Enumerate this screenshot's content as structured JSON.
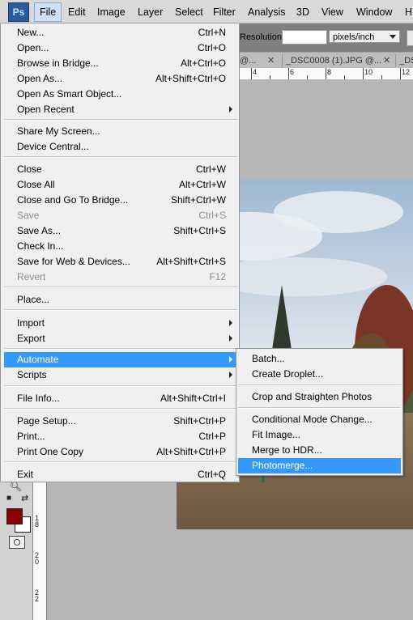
{
  "menubar": {
    "logo": "Ps",
    "items": [
      "File",
      "Edit",
      "Image",
      "Layer",
      "Select",
      "Filter",
      "Analysis",
      "3D",
      "View",
      "Window",
      "H"
    ]
  },
  "options": {
    "resolution_label": "Resolution:",
    "resolution_value": "",
    "unit_selected": "pixels/inch"
  },
  "tabs": [
    "@...",
    "_DSC0008 (1).JPG @...",
    "_DS"
  ],
  "ruler": {
    "h_labels": [
      "4",
      "6",
      "8",
      "10",
      "12"
    ],
    "v_labels": [
      "1\n8",
      "2\n0",
      "2\n2"
    ]
  },
  "file_menu": {
    "items": [
      {
        "label": "New...",
        "shortcut": "Ctrl+N"
      },
      {
        "label": "Open...",
        "shortcut": "Ctrl+O"
      },
      {
        "label": "Browse in Bridge...",
        "shortcut": "Alt+Ctrl+O"
      },
      {
        "label": "Open As...",
        "shortcut": "Alt+Shift+Ctrl+O"
      },
      {
        "label": "Open As Smart Object...",
        "shortcut": ""
      },
      {
        "label": "Open Recent",
        "shortcut": ""
      },
      {
        "label": "Share My Screen...",
        "shortcut": ""
      },
      {
        "label": "Device Central...",
        "shortcut": ""
      },
      {
        "label": "Close",
        "shortcut": "Ctrl+W"
      },
      {
        "label": "Close All",
        "shortcut": "Alt+Ctrl+W"
      },
      {
        "label": "Close and Go To Bridge...",
        "shortcut": "Shift+Ctrl+W"
      },
      {
        "label": "Save",
        "shortcut": "Ctrl+S"
      },
      {
        "label": "Save As...",
        "shortcut": "Shift+Ctrl+S"
      },
      {
        "label": "Check In...",
        "shortcut": ""
      },
      {
        "label": "Save for Web & Devices...",
        "shortcut": "Alt+Shift+Ctrl+S"
      },
      {
        "label": "Revert",
        "shortcut": "F12"
      },
      {
        "label": "Place...",
        "shortcut": ""
      },
      {
        "label": "Import",
        "shortcut": ""
      },
      {
        "label": "Export",
        "shortcut": ""
      },
      {
        "label": "Automate",
        "shortcut": ""
      },
      {
        "label": "Scripts",
        "shortcut": ""
      },
      {
        "label": "File Info...",
        "shortcut": "Alt+Shift+Ctrl+I"
      },
      {
        "label": "Page Setup...",
        "shortcut": "Shift+Ctrl+P"
      },
      {
        "label": "Print...",
        "shortcut": "Ctrl+P"
      },
      {
        "label": "Print One Copy",
        "shortcut": "Alt+Shift+Ctrl+P"
      },
      {
        "label": "Exit",
        "shortcut": "Ctrl+Q"
      }
    ]
  },
  "automate_submenu": {
    "items": [
      {
        "label": "Batch..."
      },
      {
        "label": "Create Droplet..."
      },
      {
        "label": "Crop and Straighten Photos"
      },
      {
        "label": "Conditional Mode Change..."
      },
      {
        "label": "Fit Image..."
      },
      {
        "label": "Merge to HDR..."
      },
      {
        "label": "Photomerge..."
      }
    ]
  },
  "colors": {
    "highlight": "#3399ff",
    "foreground_swatch": "#8b0000",
    "background_swatch": "#ffffff"
  }
}
